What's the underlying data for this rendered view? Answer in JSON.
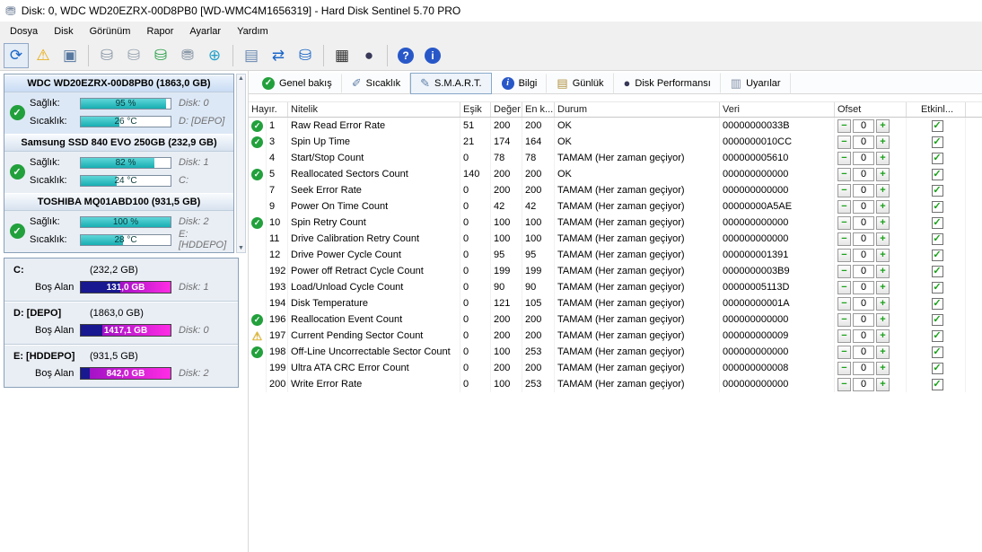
{
  "window": {
    "title": "Disk: 0, WDC WD20EZRX-00D8PB0 [WD-WMC4M1656319] - Hard Disk Sentinel 5.70 PRO",
    "title_icon": "⛃"
  },
  "menu": [
    "Dosya",
    "Disk",
    "Görünüm",
    "Rapor",
    "Ayarlar",
    "Yardım"
  ],
  "toolbar": [
    {
      "name": "refresh-icon",
      "glyph": "⟳",
      "color": "#1a66c8",
      "pressed": true
    },
    {
      "name": "warning-icon",
      "glyph": "⚠",
      "color": "#e8a800"
    },
    {
      "name": "monitor-icon",
      "glyph": "▣",
      "color": "#5878a0"
    },
    {
      "type": "sep"
    },
    {
      "name": "disk-test-icon",
      "glyph": "⛁",
      "color": "#8a98a8"
    },
    {
      "name": "disk-surface-test-icon",
      "glyph": "⛁",
      "color": "#98a4b0"
    },
    {
      "name": "disk-repair-icon",
      "glyph": "⛁",
      "color": "#28a048"
    },
    {
      "name": "disk-tools-icon",
      "glyph": "⛃",
      "color": "#8a98a8"
    },
    {
      "name": "network-icon",
      "glyph": "⊕",
      "color": "#28a0c8"
    },
    {
      "type": "sep"
    },
    {
      "name": "report-icon",
      "glyph": "▤",
      "color": "#6888b0"
    },
    {
      "name": "sync-icon",
      "glyph": "⇄",
      "color": "#1a66c8"
    },
    {
      "name": "disk-refresh-icon",
      "glyph": "⛁",
      "color": "#1a66c8"
    },
    {
      "type": "sep"
    },
    {
      "name": "chart-icon",
      "glyph": "▦",
      "color": "#303030"
    },
    {
      "name": "performance-icon",
      "glyph": "●",
      "color": "#383858"
    },
    {
      "type": "sep"
    },
    {
      "name": "help-icon",
      "glyph": "?",
      "circle": "#2858c8"
    },
    {
      "name": "info-icon",
      "glyph": "i",
      "circle": "#2858c8"
    }
  ],
  "labels": {
    "health": "Sağlık:",
    "temp": "Sıcaklık:",
    "free": "Boş Alan"
  },
  "sidebar": {
    "disks": [
      {
        "name": "WDC WD20EZRX-00D8PB0 (1863,0 GB)",
        "health": "95 %",
        "health_pct": 95,
        "disk": "Disk: 0",
        "temp": "26 °C",
        "temp_pct": 43,
        "drive": "D: [DEPO]"
      },
      {
        "name": "Samsung SSD 840 EVO 250GB (232,9 GB)",
        "health": "82 %",
        "health_pct": 82,
        "disk": "Disk: 1",
        "temp": "24 °C",
        "temp_pct": 40,
        "drive": "C:"
      },
      {
        "name": "TOSHIBA MQ01ABD100 (931,5 GB)",
        "health": "100 %",
        "health_pct": 100,
        "disk": "Disk: 2",
        "temp": "28 °C",
        "temp_pct": 47,
        "drive": "E: [HDDEPO]"
      }
    ],
    "partitions": [
      {
        "name": "C:",
        "size": "(232,2 GB)",
        "free": "131,0 GB",
        "free_pct": 56,
        "disk": "Disk: 1"
      },
      {
        "name": "D: [DEPO]",
        "size": "(1863,0 GB)",
        "free": "1417,1 GB",
        "free_pct": 76,
        "disk": "Disk: 0"
      },
      {
        "name": "E: [HDDEPO]",
        "size": "(931,5 GB)",
        "free": "842,0 GB",
        "free_pct": 90,
        "disk": "Disk: 2"
      }
    ]
  },
  "tabs": [
    {
      "label": "Genel bakış",
      "icon": "check-circle"
    },
    {
      "label": "Sıcaklık",
      "icon": "thermometer"
    },
    {
      "label": "S.M.A.R.T.",
      "icon": "pencil",
      "selected": true
    },
    {
      "label": "Bilgi",
      "icon": "info-circle"
    },
    {
      "label": "Günlük",
      "icon": "log"
    },
    {
      "label": "Disk Performansı",
      "icon": "sphere"
    },
    {
      "label": "Uyarılar",
      "icon": "alerts"
    }
  ],
  "table": {
    "headers": [
      "Hayır.",
      "Nitelik",
      "Eşik",
      "Değer",
      "En k...",
      "Durum",
      "Veri",
      "Ofset",
      "Etkinl..."
    ],
    "rows": [
      {
        "icon": "ok",
        "no": "1",
        "name": "Raw Read Error Rate",
        "esik": "51",
        "deger": "200",
        "enk": "200",
        "durum": "OK",
        "veri": "00000000033B",
        "ofset": "0",
        "etkin": true
      },
      {
        "icon": "ok",
        "no": "3",
        "name": "Spin Up Time",
        "esik": "21",
        "deger": "174",
        "enk": "164",
        "durum": "OK",
        "veri": "0000000010CC",
        "ofset": "0",
        "etkin": true
      },
      {
        "icon": "",
        "no": "4",
        "name": "Start/Stop Count",
        "esik": "0",
        "deger": "78",
        "enk": "78",
        "durum": "TAMAM (Her zaman geçiyor)",
        "veri": "000000005610",
        "ofset": "0",
        "etkin": true
      },
      {
        "icon": "ok",
        "no": "5",
        "name": "Reallocated Sectors Count",
        "esik": "140",
        "deger": "200",
        "enk": "200",
        "durum": "OK",
        "veri": "000000000000",
        "ofset": "0",
        "etkin": true
      },
      {
        "icon": "",
        "no": "7",
        "name": "Seek Error Rate",
        "esik": "0",
        "deger": "200",
        "enk": "200",
        "durum": "TAMAM (Her zaman geçiyor)",
        "veri": "000000000000",
        "ofset": "0",
        "etkin": true
      },
      {
        "icon": "",
        "no": "9",
        "name": "Power On Time Count",
        "esik": "0",
        "deger": "42",
        "enk": "42",
        "durum": "TAMAM (Her zaman geçiyor)",
        "veri": "00000000A5AE",
        "ofset": "0",
        "etkin": true
      },
      {
        "icon": "ok",
        "no": "10",
        "name": "Spin Retry Count",
        "esik": "0",
        "deger": "100",
        "enk": "100",
        "durum": "TAMAM (Her zaman geçiyor)",
        "veri": "000000000000",
        "ofset": "0",
        "etkin": true
      },
      {
        "icon": "",
        "no": "11",
        "name": "Drive Calibration Retry Count",
        "esik": "0",
        "deger": "100",
        "enk": "100",
        "durum": "TAMAM (Her zaman geçiyor)",
        "veri": "000000000000",
        "ofset": "0",
        "etkin": true
      },
      {
        "icon": "",
        "no": "12",
        "name": "Drive Power Cycle Count",
        "esik": "0",
        "deger": "95",
        "enk": "95",
        "durum": "TAMAM (Her zaman geçiyor)",
        "veri": "000000001391",
        "ofset": "0",
        "etkin": true
      },
      {
        "icon": "",
        "no": "192",
        "name": "Power off Retract Cycle Count",
        "esik": "0",
        "deger": "199",
        "enk": "199",
        "durum": "TAMAM (Her zaman geçiyor)",
        "veri": "0000000003B9",
        "ofset": "0",
        "etkin": true
      },
      {
        "icon": "",
        "no": "193",
        "name": "Load/Unload Cycle Count",
        "esik": "0",
        "deger": "90",
        "enk": "90",
        "durum": "TAMAM (Her zaman geçiyor)",
        "veri": "00000005113D",
        "ofset": "0",
        "etkin": true
      },
      {
        "icon": "",
        "no": "194",
        "name": "Disk Temperature",
        "esik": "0",
        "deger": "121",
        "enk": "105",
        "durum": "TAMAM (Her zaman geçiyor)",
        "veri": "00000000001A",
        "ofset": "0",
        "etkin": true
      },
      {
        "icon": "ok",
        "no": "196",
        "name": "Reallocation Event Count",
        "esik": "0",
        "deger": "200",
        "enk": "200",
        "durum": "TAMAM (Her zaman geçiyor)",
        "veri": "000000000000",
        "ofset": "0",
        "etkin": true
      },
      {
        "icon": "warn",
        "no": "197",
        "name": "Current Pending Sector Count",
        "esik": "0",
        "deger": "200",
        "enk": "200",
        "durum": "TAMAM (Her zaman geçiyor)",
        "veri": "000000000009",
        "ofset": "0",
        "etkin": true
      },
      {
        "icon": "ok",
        "no": "198",
        "name": "Off-Line Uncorrectable Sector Count",
        "esik": "0",
        "deger": "100",
        "enk": "253",
        "durum": "TAMAM (Her zaman geçiyor)",
        "veri": "000000000000",
        "ofset": "0",
        "etkin": true
      },
      {
        "icon": "",
        "no": "199",
        "name": "Ultra ATA CRC Error Count",
        "esik": "0",
        "deger": "200",
        "enk": "200",
        "durum": "TAMAM (Her zaman geçiyor)",
        "veri": "000000000008",
        "ofset": "0",
        "etkin": true
      },
      {
        "icon": "",
        "no": "200",
        "name": "Write Error Rate",
        "esik": "0",
        "deger": "100",
        "enk": "253",
        "durum": "TAMAM (Her zaman geçiyor)",
        "veri": "000000000000",
        "ofset": "0",
        "etkin": true
      }
    ]
  },
  "colors": {
    "accent_teal": "#17aeb2",
    "free_magenta": "#ff2ce4",
    "used_blue": "#181890",
    "ok_green": "#22a03c",
    "warning_yellow": "#f2b800"
  }
}
